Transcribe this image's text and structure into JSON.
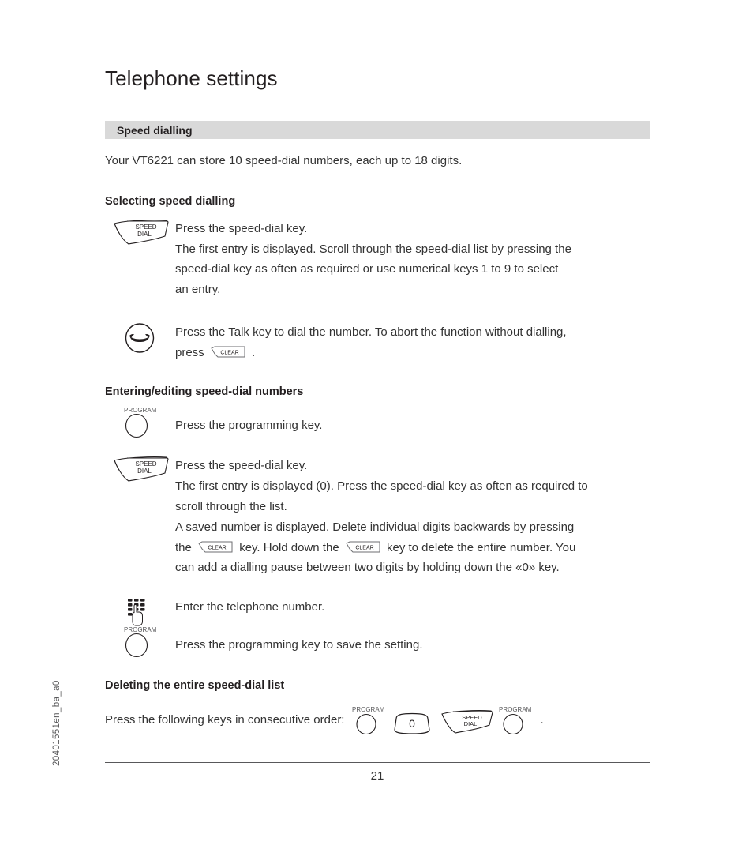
{
  "document": {
    "title": "Telephone settings",
    "doc_id": "20401551en_ba_a0",
    "page_number": "21"
  },
  "section": {
    "band_label": "Speed dialling",
    "intro": "Your VT6221 can store 10 speed-dial numbers, each up to 18 digits."
  },
  "subsections": [
    {
      "heading": "Selecting speed dialling",
      "steps": [
        {
          "key_icon": "speed-dial-key-icon",
          "key_label_top": "SPEED",
          "key_label_bottom": "DIAL",
          "lines": [
            "Press the speed-dial key.",
            "The first entry is displayed. Scroll through the speed-dial list by pressing the",
            "speed-dial key as often as required or use numerical keys 1 to 9 to select",
            "an entry."
          ]
        },
        {
          "key_icon": "talk-key-icon",
          "lines": [
            "Press the Talk key to dial the number. To abort the function without dialling,"
          ],
          "last_line_prefix": "press ",
          "inline_key": "CLEAR",
          "last_line_suffix": " ."
        }
      ]
    },
    {
      "heading": "Entering/editing speed-dial numbers",
      "steps": [
        {
          "key_icon": "program-key-icon",
          "key_label": "PROGRAM",
          "lines": [
            "Press the programming key."
          ]
        },
        {
          "key_icon": "speed-dial-key-icon",
          "key_label_top": "SPEED",
          "key_label_bottom": "DIAL",
          "lines": [
            "Press the speed-dial key.",
            "The first entry is displayed (0). Press the speed-dial key as often as required to",
            "scroll through the list.",
            "A saved number is displayed. Delete individual digits backwards by pressing"
          ],
          "clear_line": {
            "part1": "the ",
            "key1": "CLEAR",
            "part2": " key. Hold down the ",
            "key2": "CLEAR",
            "part3": " key to delete the entire number. You"
          },
          "final_line": "can add a dialling pause between two digits by holding down the «0» key."
        },
        {
          "key_icon": "keypad-key-icon",
          "lines": [
            "Enter the telephone number."
          ]
        },
        {
          "key_icon": "program-key-icon",
          "key_label": "PROGRAM",
          "lines": [
            "Press the programming key to save the setting."
          ]
        }
      ]
    },
    {
      "heading": "Deleting the entire speed-dial list",
      "delete_instruction": "Press the following keys in consecutive order:",
      "key_sequence": [
        {
          "icon": "program-key-icon",
          "label": "PROGRAM"
        },
        {
          "icon": "zero-key-icon",
          "label": "0"
        },
        {
          "icon": "speed-dial-key-icon",
          "label_top": "SPEED",
          "label_bottom": "DIAL"
        },
        {
          "icon": "program-key-icon",
          "label": "PROGRAM"
        }
      ],
      "trailing_period": "."
    }
  ],
  "colors": {
    "band_background": "#d9d9d9",
    "text": "#333333",
    "heading": "#231f20",
    "rule": "#58585a"
  }
}
